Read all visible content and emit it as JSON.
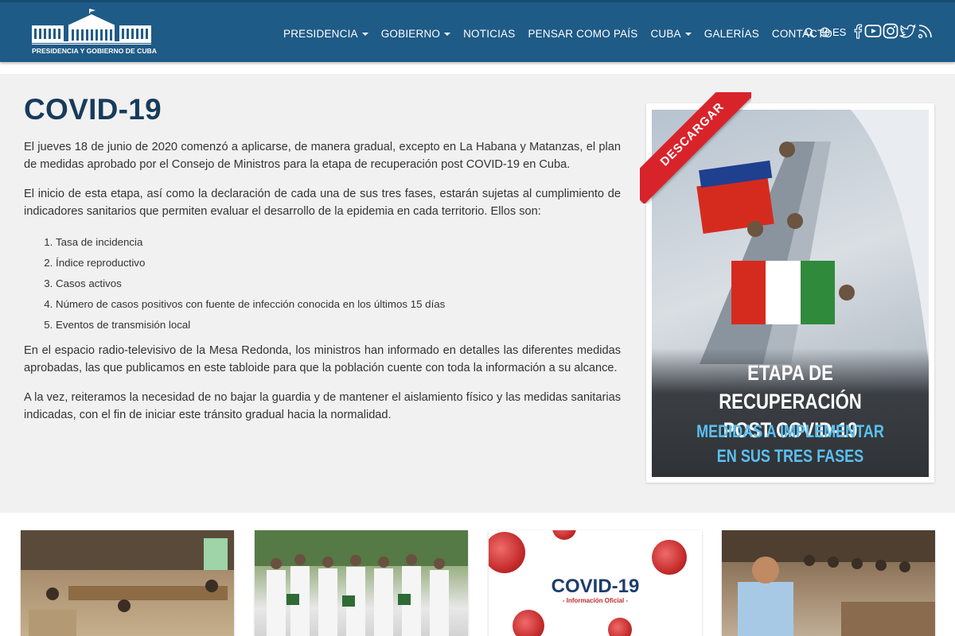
{
  "header": {
    "logo_text": "PRESIDENCIA Y GOBIERNO DE CUBA",
    "nav": [
      {
        "label": "PRESIDENCIA",
        "dropdown": true
      },
      {
        "label": "GOBIERNO",
        "dropdown": true
      },
      {
        "label": "NOTICIAS",
        "dropdown": false
      },
      {
        "label": "PENSAR COMO PAÍS",
        "dropdown": false
      },
      {
        "label": "CUBA",
        "dropdown": true
      },
      {
        "label": "GALERÍAS",
        "dropdown": false
      },
      {
        "label": "CONTACTO",
        "dropdown": false
      }
    ],
    "language": "ES",
    "social_icons": [
      "facebook-icon",
      "youtube-icon",
      "instagram-icon",
      "twitter-icon",
      "rss-icon"
    ]
  },
  "article": {
    "title": "COVID-19",
    "paragraph1": "El jueves 18 de junio de 2020 comenzó a aplicarse, de manera gradual, excepto en La Habana y Matanzas, el plan de medidas aprobado por el Consejo de Ministros para la etapa de recuperación post COVID-19 en Cuba.",
    "paragraph2": "El inicio de esta etapa, así como la declaración de cada una de sus tres fases, estarán sujetas al cumplimiento de indicadores sanitarios que permiten evaluar el desarrollo de la epidemia en cada territorio. Ellos son:",
    "indicators": [
      "Tasa de incidencia",
      " Índice reproductivo",
      "Casos activos",
      "Número de casos positivos con fuente de infección conocida en los últimos 15 días",
      "Eventos de transmisión local"
    ],
    "paragraph3": "En el espacio radio-televisivo de la Mesa Redonda, los ministros han informado en detalles las diferentes medidas aprobadas, las que publicamos en este tabloide para que la población cuente con toda la información a su alcance.",
    "paragraph4": "A la vez, reiteramos la necesidad de no bajar la guardia y de mantener el aislamiento físico y las medidas sanitarias indicadas, con el fin de iniciar este tránsito gradual hacia la normalidad."
  },
  "promo": {
    "ribbon": "DESCARGAR",
    "line1": "ETAPA DE RECUPERACIÓN",
    "line2": "POST COVID-19",
    "line3": "MEDIDAS A IMPLEMENTAR",
    "line4": "EN SUS TRES FASES"
  },
  "cards": {
    "covid_title": "COVID-19",
    "covid_subtitle": "- Información Oficial -"
  }
}
